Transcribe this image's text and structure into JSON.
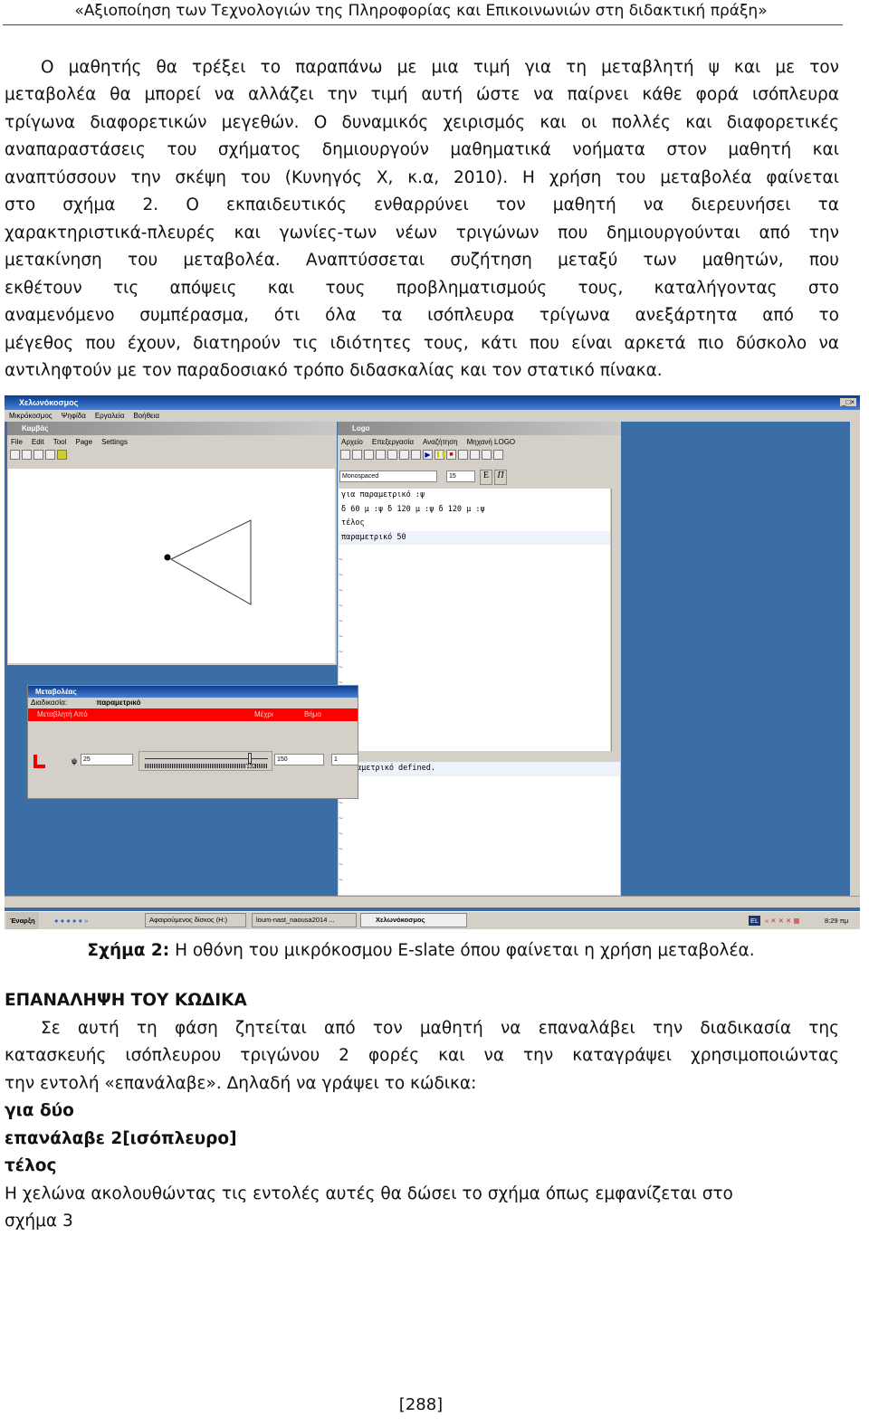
{
  "header": "«Αξιοποίηση των Τεχνολογιών της Πληροφορίας και Επικοινωνιών στη διδακτική πράξη»",
  "paragraph1": [
    "Ο μαθητής θα τρέξει το παραπάνω με μια τιμή για τη μεταβλητή ψ και με τον",
    "μεταβολέα θα μπορεί να αλλάζει την τιμή αυτή ώστε να παίρνει κάθε φορά ισόπλευρα",
    "τρίγωνα διαφορετικών μεγεθών. Ο δυναμικός χειρισμός και οι πολλές και διαφορετικές",
    "αναπαραστάσεις του σχήματος δημιουργούν μαθηματικά νοήματα στον μαθητή και",
    "αναπτύσσουν την σκέψη του (Κυνηγός Χ, κ.α, 2010). Η χρήση του μεταβολέα φαίνεται",
    "στο σχήμα 2. Ο εκπαιδευτικός ενθαρρύνει τον μαθητή να διερευνήσει τα",
    "χαρακτηριστικά-πλευρές και γωνίες-των νέων τριγώνων που δημιουργούνται από την",
    "μετακίνηση του μεταβολέα. Αναπτύσσεται συζήτηση μεταξύ των μαθητών, που",
    "εκθέτουν τις απόψεις και τους προβληματισμούς τους, καταλήγοντας στο",
    "αναμενόμενο συμπέρασμα, ότι όλα τα ισόπλευρα τρίγωνα ανεξάρτητα από το",
    "μέγεθος που έχουν, διατηρούν τις ιδιότητες τους, κάτι που είναι αρκετά πιο δύσκολο να",
    "αντιληφτούν με τον παραδοσιακό τρόπο διδασκαλίας και τον στατικό πίνακα."
  ],
  "screenshot": {
    "app_title": "Χελωνόκοσμος",
    "app_menu": [
      "Μικρόκοσμος",
      "Ψηφίδα",
      "Εργαλεία",
      "Βοήθεια"
    ],
    "canvas": {
      "title": "Καμβάς",
      "menu": [
        "File",
        "Edit",
        "Tool",
        "Page",
        "Settings"
      ]
    },
    "logo": {
      "title": "Logo",
      "menu": [
        "Αρχείο",
        "Επεξεργασία",
        "Αναζήτηση",
        "Μηχανή LOGO"
      ],
      "font": "Monospaced",
      "size": "15",
      "bold": "E",
      "italic": "Π",
      "code": [
        "για παραμετρικό :ψ",
        "δ 60  μ :ψ  δ 120  μ :ψ  δ 120  μ :ψ",
        "τέλος",
        "παραμετρικό 50"
      ],
      "output": "αμετρικό defined."
    },
    "slider": {
      "title": "Μεταβολέας",
      "proc_label": "Διαδικασία:",
      "proc_value": "παραμετρικό",
      "col_var": "Μεταβλητή Από",
      "col_to": "Μέχρι",
      "col_step": "Βήμα",
      "var": "ψ",
      "from": "25",
      "to": "150",
      "step": "1",
      "current": "132",
      "level": 0.856
    },
    "taskbar": {
      "start": "Έναρξη",
      "items": [
        "Αφαιρούμενος δίσκος (H:)",
        "loum-nast_naousa2014 ...",
        "Χελωνόκοσμος"
      ],
      "time": "8:29 πμ",
      "lang": "EL"
    }
  },
  "caption": {
    "label": "Σχήμα 2:",
    "text": " Η οθόνη του μικρόκοσμου E-slate όπου φαίνεται η χρήση μεταβολέα."
  },
  "heading": "ΕΠΑΝΑΛΗΨΗ ΤΟΥ ΚΩΔΙΚΑ",
  "paragraph2": [
    "Σε αυτή τη φάση ζητείται από τον μαθητή να επαναλάβει την διαδικασία της",
    "κατασκευής ισόπλευρου τριγώνου 2 φορές και να την καταγράψει χρησιμοποιώντας",
    "την εντολή «επανάλαβε». Δηλαδή να γράψει το κώδικα:"
  ],
  "code": [
    "για δύο",
    "επανάλαβε 2[ισόπλευρο]",
    "τέλος"
  ],
  "paragraph3": [
    "Η χελώνα ακολουθώντας τις εντολές αυτές θα δώσει το σχήμα  όπως εμφανίζεται στο",
    "σχήμα 3"
  ],
  "page_number": "[288]"
}
